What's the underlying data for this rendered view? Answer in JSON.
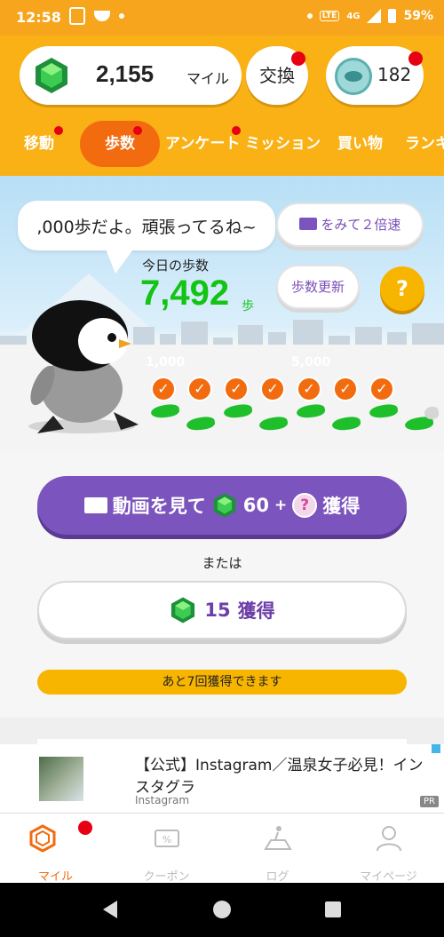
{
  "status_bar": {
    "time": "12:58",
    "battery": "59%",
    "network": "4G"
  },
  "header": {
    "miles_value": "2,155",
    "miles_unit": "マイル",
    "exchange_label": "交換",
    "tickets_value": "182"
  },
  "tabs": [
    {
      "label": "移動"
    },
    {
      "label": "歩数"
    },
    {
      "label": "アンケート"
    },
    {
      "label": "ミッション"
    },
    {
      "label": "買い物"
    },
    {
      "label": "ランキ"
    }
  ],
  "hero": {
    "speech": ",000歩だよ。頑張ってるね~",
    "video_speed_label": "をみて２倍速",
    "steps_label": "今日の歩数",
    "steps_value": "7,492",
    "steps_unit": "歩",
    "update_label": "歩数更新",
    "help_label": "?",
    "milestones": [
      "1,000",
      "5,000"
    ],
    "completed_checks": 7
  },
  "actions": {
    "watch_prefix": "動画を見て",
    "watch_amount": "60",
    "watch_plus": "+",
    "watch_suffix": "獲得",
    "or_text": "または",
    "earn_amount": "15",
    "earn_suffix": "獲得",
    "remaining_text": "あと7回獲得できます"
  },
  "ad": {
    "title": "【公式】Instagram／温泉女子必見！インスタグラ",
    "source": "Instagram",
    "pr_label": "PR"
  },
  "bottom_nav": [
    {
      "label": "マイル"
    },
    {
      "label": "クーポン"
    },
    {
      "label": "ログ"
    },
    {
      "label": "マイページ"
    }
  ],
  "colors": {
    "header": "#f9b115",
    "accent": "#f26b0f",
    "purple": "#7b54be",
    "green": "#14c414"
  }
}
